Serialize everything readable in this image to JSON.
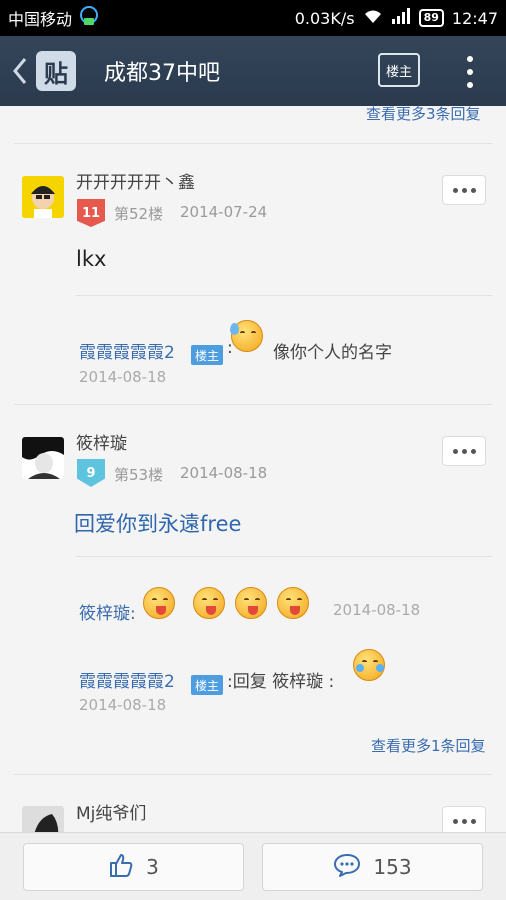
{
  "status_bar": {
    "carrier": "中国移动",
    "speed": "0.03K/s",
    "battery": "89",
    "time": "12:47"
  },
  "header": {
    "logo_text": "贴",
    "title": "成都37中吧",
    "owner_button": "楼主"
  },
  "top_more_replies": "查看更多3条回复",
  "posts": [
    {
      "username": "开开开开开丶鑫",
      "level": "11",
      "floor": "第52楼",
      "date": "2014-07-24",
      "content": "lkx",
      "replies": [
        {
          "user": "霞霞霞霞霞2",
          "tag": "楼主",
          "colon": ":",
          "text": "像你个人的名字",
          "date": "2014-08-18"
        }
      ]
    },
    {
      "username": "筱梓璇",
      "level": "9",
      "floor": "第53楼",
      "date": "2014-08-18",
      "content": "回爱你到永遠free",
      "replies": [
        {
          "user": "筱梓璇:",
          "date": "2014-08-18"
        },
        {
          "user": "霞霞霞霞霞2",
          "tag": "楼主",
          "text": ":回复 筱梓璇 :",
          "date": "2014-08-18"
        }
      ],
      "more_replies": "查看更多1条回复"
    },
    {
      "username": "Mj纯爷们"
    }
  ],
  "bottom_bar": {
    "likes": "3",
    "comments": "153"
  },
  "colors": {
    "header_bg": "#2b3a4d",
    "link": "#3a6cb0",
    "owner_tag": "#4d9de0",
    "level_red": "#e55a4d",
    "level_cyan": "#5ec4de"
  }
}
